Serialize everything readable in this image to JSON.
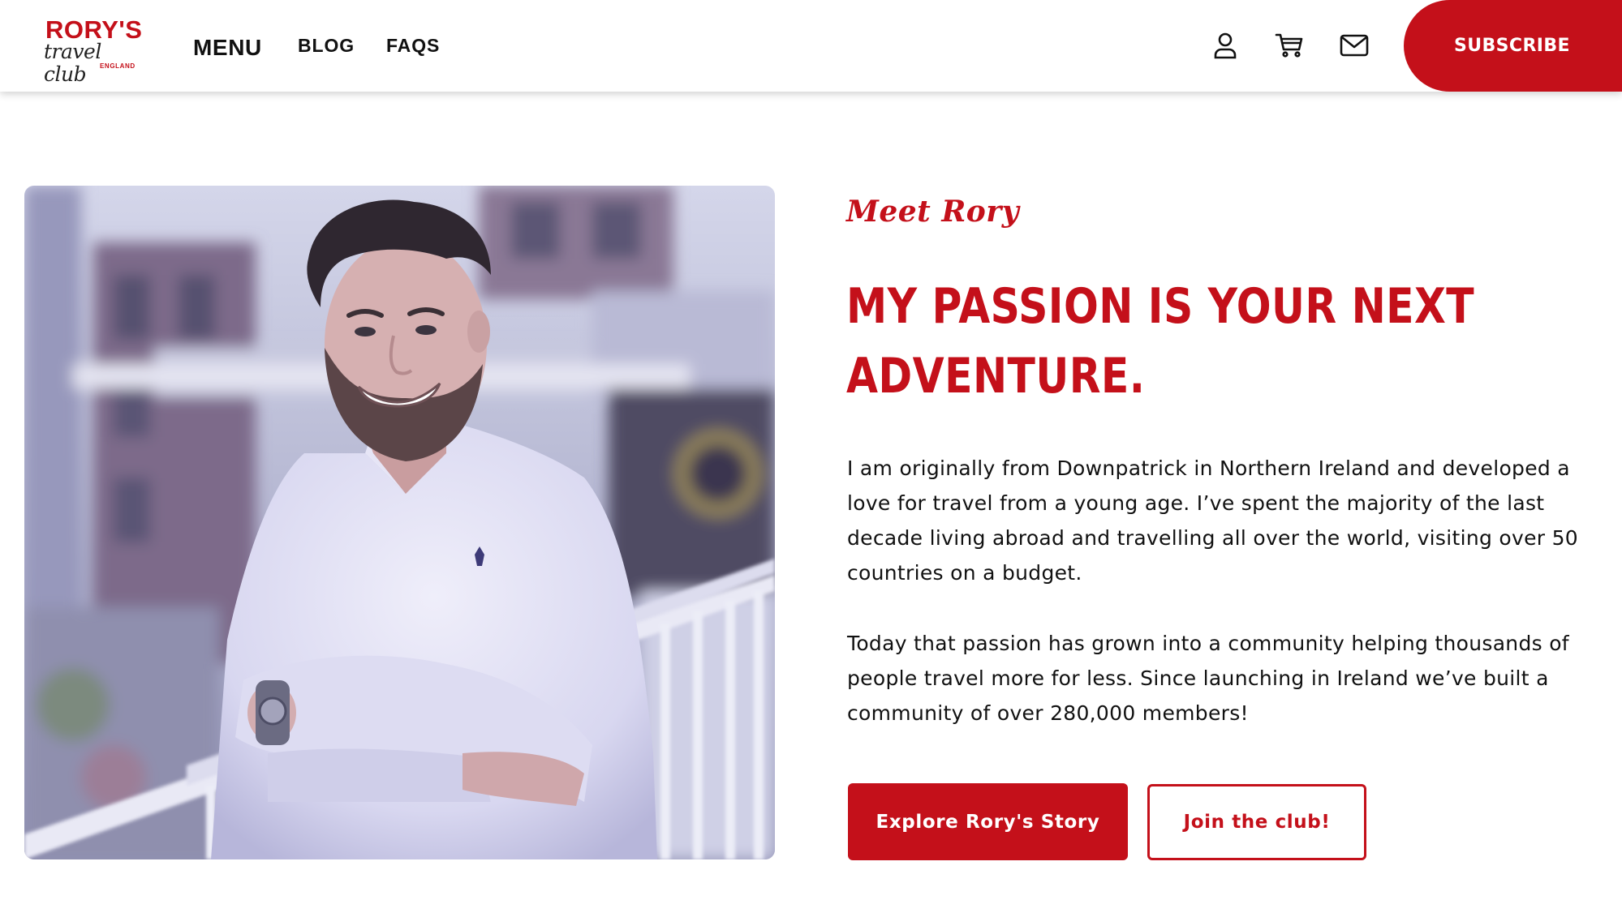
{
  "header": {
    "logo": {
      "wordmark": "RORY'S",
      "subline": "travel club",
      "country": "ENGLAND"
    },
    "nav": {
      "menu_label": "MENU",
      "blog_label": "BLOG",
      "faqs_label": "FAQS"
    },
    "icons": [
      "account-icon",
      "cart-icon",
      "mail-icon"
    ],
    "subscribe_label": "SUBSCRIBE"
  },
  "hero": {
    "eyebrow": "Meet Rory",
    "headline_line1": "MY PASSION IS YOUR NEXT",
    "headline_line2": "ADVENTURE.",
    "paragraph1": "I am originally from Downpatrick in Northern Ireland and developed a love for travel from a young age. I’ve spent the majority of the last decade living abroad and travelling all over the world, visiting over 50 countries on a budget.",
    "paragraph2": "Today that passion has grown into a community helping thousands of people travel more for less. Since launching in Ireland we’ve built a community of over 280,000 members!",
    "primary_button": "Explore Rory's Story",
    "secondary_button": "Join the club!"
  },
  "colors": {
    "brand_red": "#c4101a",
    "text": "#111111",
    "background": "#ffffff"
  }
}
